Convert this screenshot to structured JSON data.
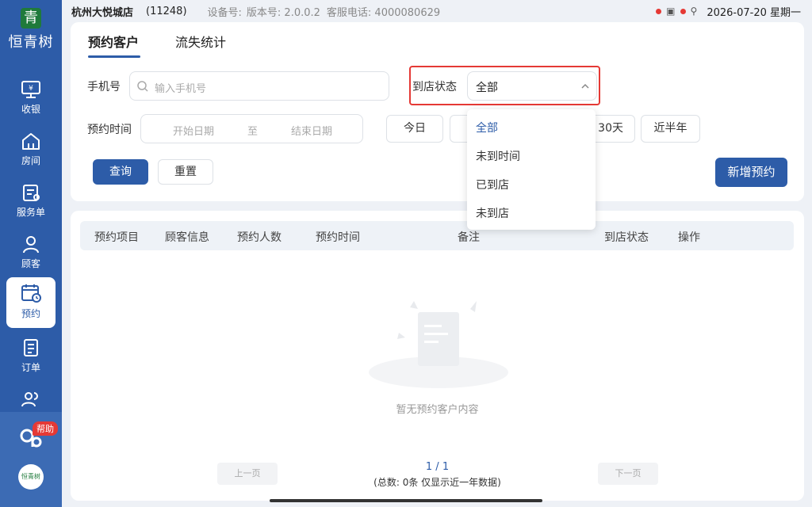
{
  "statusbar": {
    "store": "杭州大悦城店",
    "code": "(11248)",
    "device": "设备号:",
    "version": "版本号: 2.0.0.2",
    "service": "客服电话: 4000080629",
    "datetime": "2026-07-20 星期一"
  },
  "sidebar": {
    "logo_mark": "青",
    "logo_name": "恒青树",
    "items": [
      {
        "label": "收银",
        "icon": "cashier-icon"
      },
      {
        "label": "房间",
        "icon": "house-icon"
      },
      {
        "label": "服务单",
        "icon": "service-order-icon"
      },
      {
        "label": "顾客",
        "icon": "customer-icon"
      },
      {
        "label": "预约",
        "icon": "calendar-clock-icon"
      },
      {
        "label": "订单",
        "icon": "order-icon"
      },
      {
        "label": "",
        "icon": "users-icon"
      }
    ],
    "help_badge": "帮助",
    "avatar_text": "恒青树"
  },
  "tabs": [
    "预约客户",
    "流失统计"
  ],
  "filters": {
    "phone_label": "手机号",
    "phone_placeholder": "输入手机号",
    "status_label": "到店状态",
    "status_value": "全部",
    "time_label": "预约时间",
    "start_placeholder": "开始日期",
    "to": "至",
    "end_placeholder": "结束日期",
    "quick": [
      "今日",
      "",
      "30天",
      "近半年"
    ],
    "query": "查询",
    "reset": "重置",
    "add": "新增预约"
  },
  "dropdown_options": [
    "全部",
    "未到时间",
    "已到店",
    "未到店"
  ],
  "table": {
    "headers": [
      "预约项目",
      "顾客信息",
      "预约人数",
      "预约时间",
      "备注",
      "到店状态",
      "操作"
    ],
    "empty": "暂无预约客户内容"
  },
  "pagination": {
    "prev": "上一页",
    "next": "下一页",
    "page": "1 / 1",
    "total": "(总数: 0条 仅显示近一年数据)"
  }
}
